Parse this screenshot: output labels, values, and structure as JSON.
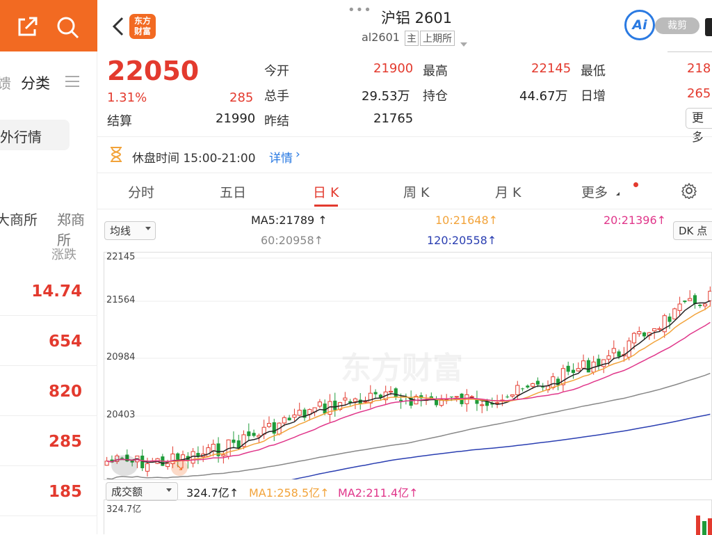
{
  "left_panel": {
    "tab_partial": "馈",
    "tab_category": "分类",
    "foreign_market": "外行情",
    "exchanges": [
      "大商所",
      "郑商所"
    ],
    "change_header": "涨跌",
    "values": [
      "14.74",
      "654",
      "820",
      "285",
      "185"
    ]
  },
  "header": {
    "title": "沪铝 2601",
    "code": "al2601",
    "badge_main": "主",
    "badge_exchange": "上期所",
    "ai_label": "Ai",
    "crop_label": "裁剪"
  },
  "quote": {
    "price": "22050",
    "change_pct": "1.31%",
    "change": "285",
    "settle_label": "结算",
    "settle": "21990",
    "open_label": "今开",
    "open": "21900",
    "volume_label": "总手",
    "volume": "29.53万",
    "prev_settle_label": "昨结",
    "prev_settle": "21765",
    "high_label": "最高",
    "high": "22145",
    "oi_label": "持仓",
    "oi": "44.67万",
    "low_label": "最低",
    "low": "218",
    "daily_inc_label": "日增",
    "daily_inc": "265",
    "more": "更多"
  },
  "break_notice": {
    "text": "休盘时间 15:00-21:00",
    "link": "详情"
  },
  "tabs": [
    "分时",
    "五日",
    "日 K",
    "周 K",
    "月 K",
    "更多"
  ],
  "ma_bar": {
    "select": "均线",
    "ma5": "MA5:21789",
    "ma10": "10:21648",
    "ma20": "20:21396",
    "ma60": "60:20958",
    "ma120": "120:20558",
    "dk": "DK 点"
  },
  "vol_bar": {
    "select": "成交额",
    "value": "324.7亿",
    "ma1": "MA1:258.5亿",
    "ma2": "MA2:211.4亿",
    "scale": "324.7亿"
  },
  "watermark": "东方财富",
  "chart_data": {
    "type": "candlestick",
    "y_ticks": [
      "22145",
      "21564",
      "20984",
      "20403"
    ],
    "lines": [
      {
        "name": "MA5",
        "color": "#222222"
      },
      {
        "name": "MA10",
        "color": "#f2a33a"
      },
      {
        "name": "MA20",
        "color": "#e0368a"
      },
      {
        "name": "MA60",
        "color": "#888888"
      },
      {
        "name": "MA120",
        "color": "#2a3eb1"
      }
    ]
  },
  "colors": {
    "up": "#e33a2e",
    "down": "#1f9b3a",
    "brand": "#f26a22"
  }
}
